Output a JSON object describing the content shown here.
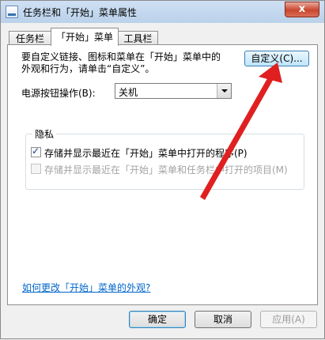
{
  "window": {
    "title": "任务栏和「开始」菜单属性",
    "close_label": "x"
  },
  "tabs": [
    {
      "label": "任务栏"
    },
    {
      "label": "「开始」菜单"
    },
    {
      "label": "工具栏"
    }
  ],
  "start_menu": {
    "description": "要自定义链接、图标和菜单在「开始」菜单中的\n外观和行为，请单击“自定义”。",
    "customize_button": "自定义(C)...",
    "power_label": "电源按钮操作(B):",
    "power_selected": "关机"
  },
  "privacy": {
    "group_label": "隐私",
    "options": [
      {
        "label": "存储并显示最近在「开始」菜单中打开的程序(P)",
        "checked": true,
        "enabled": true
      },
      {
        "label": "存储并显示最近在「开始」菜单和任务栏中打开的项目(M)",
        "checked": false,
        "enabled": false
      }
    ]
  },
  "help_link": "如何更改「开始」菜单的外观?",
  "buttons": {
    "ok": "确定",
    "cancel": "取消",
    "apply": "应用(A)"
  },
  "annotation_color": "#e02020"
}
